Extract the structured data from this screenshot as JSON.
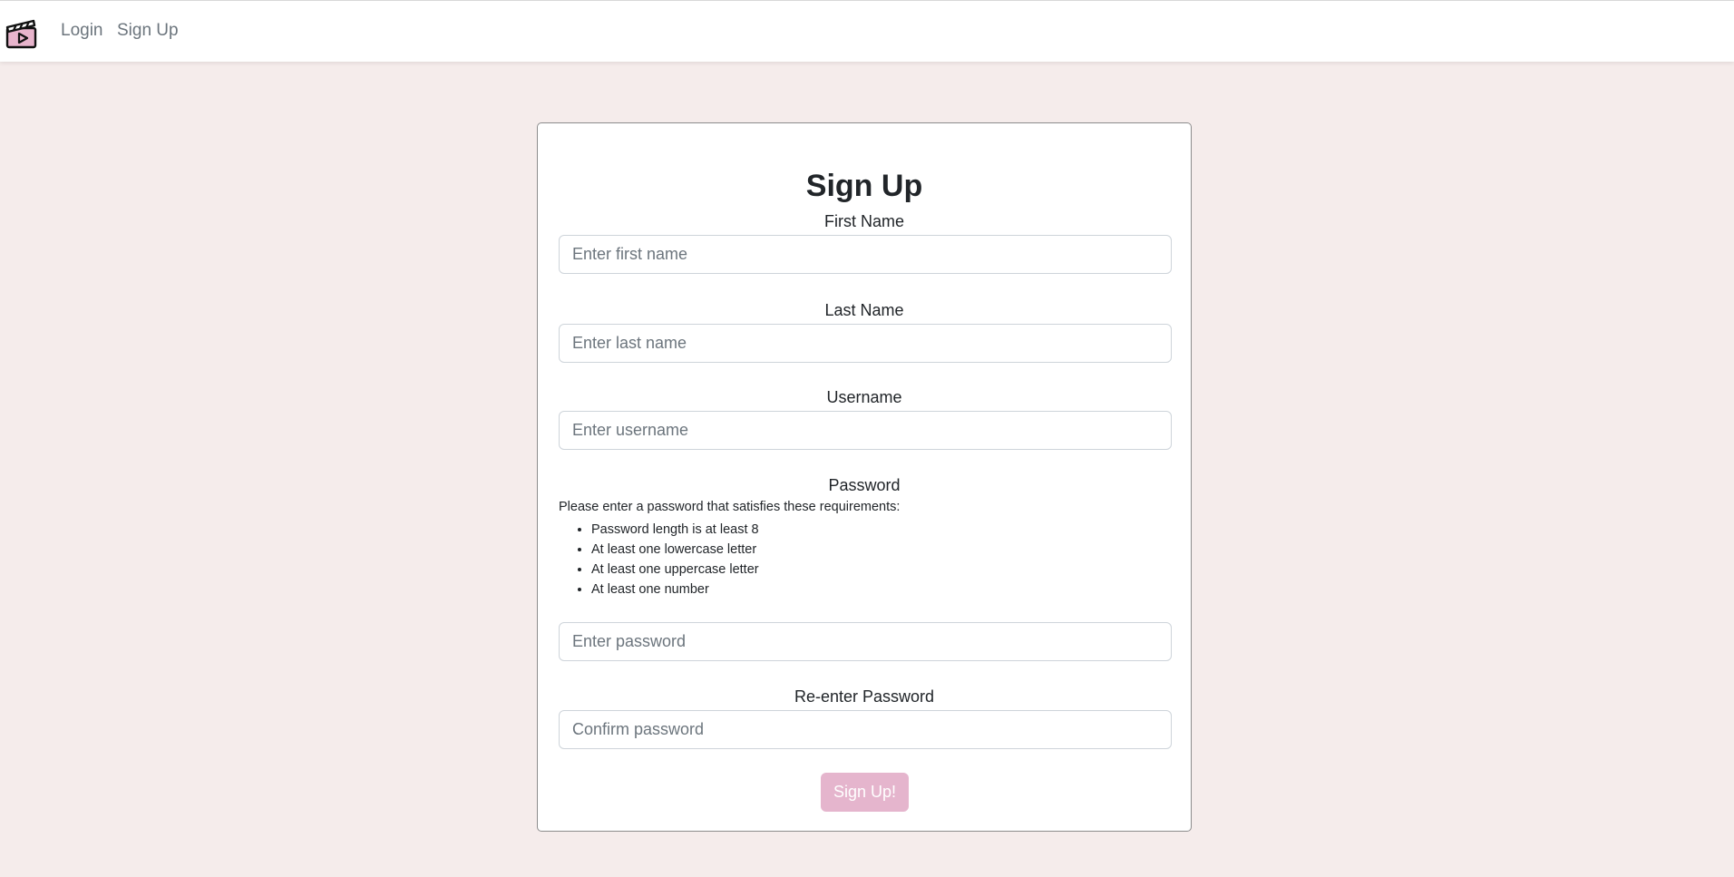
{
  "nav": {
    "logo_icon": "clapperboard-icon",
    "login_label": "Login",
    "signup_label": "Sign Up"
  },
  "form": {
    "title": "Sign Up",
    "first_name": {
      "label": "First Name",
      "placeholder": "Enter first name",
      "value": ""
    },
    "last_name": {
      "label": "Last Name",
      "placeholder": "Enter last name",
      "value": ""
    },
    "username": {
      "label": "Username",
      "placeholder": "Enter username",
      "value": ""
    },
    "password": {
      "label": "Password",
      "requirements_intro": "Please enter a password that satisfies these requirements:",
      "requirements": [
        "Password length is at least 8",
        "At least one lowercase letter",
        "At least one uppercase letter",
        "At least one number"
      ],
      "placeholder": "Enter password",
      "value": ""
    },
    "confirm_password": {
      "label": "Re-enter Password",
      "placeholder": "Confirm password",
      "value": ""
    },
    "submit_label": "Sign Up!"
  },
  "colors": {
    "page_background": "#f5eceb",
    "accent": "#e5b5cd",
    "logo_fill": "#e8b4cc"
  }
}
